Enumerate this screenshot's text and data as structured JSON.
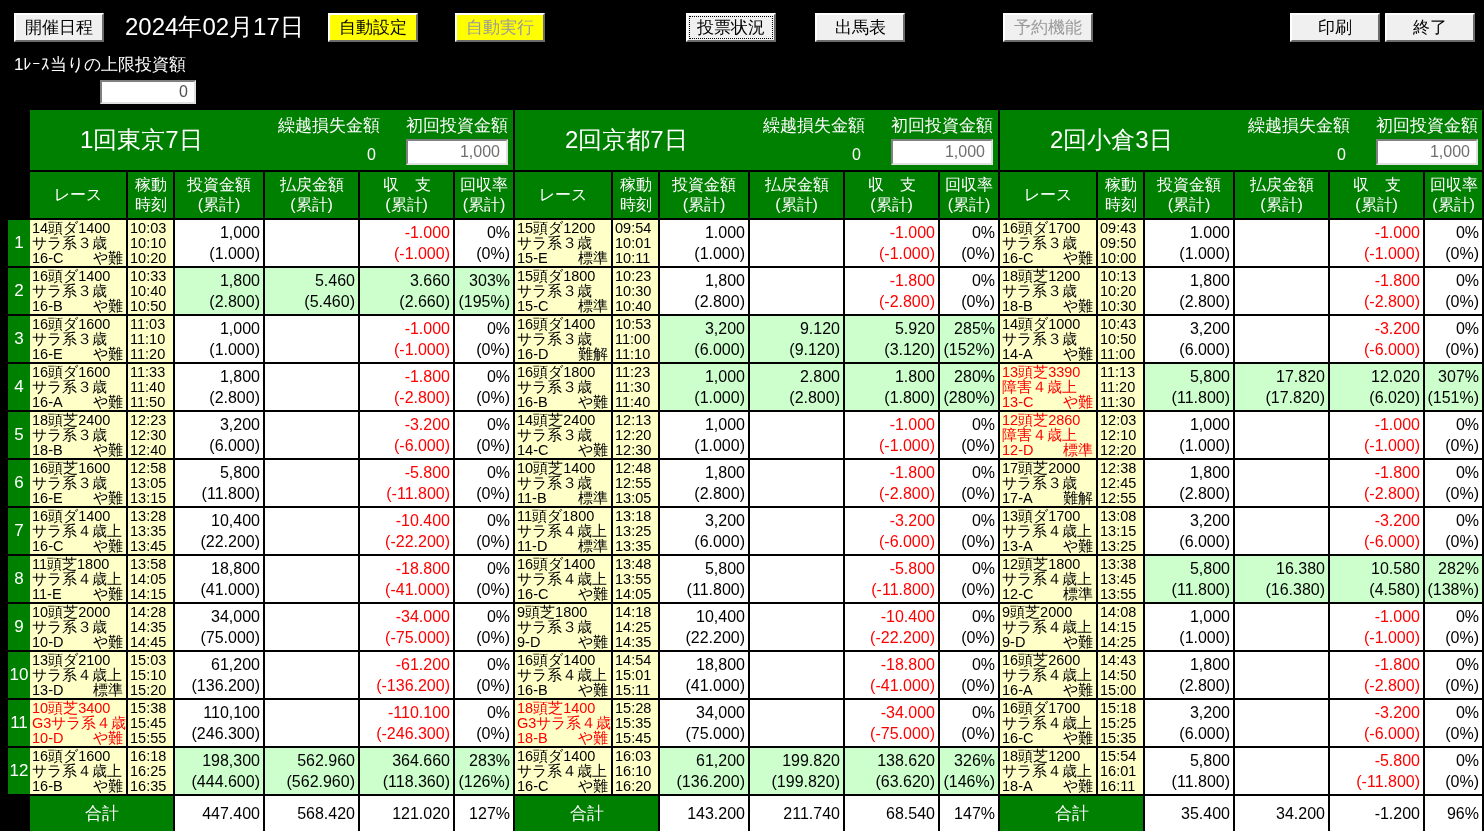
{
  "toolbar": {
    "items": [
      {
        "kind": "button",
        "label": "開催日程",
        "disabled": false,
        "focused": false
      },
      {
        "kind": "date",
        "label": "2024年02月17日"
      },
      {
        "kind": "highlighted",
        "label": "自動設定",
        "disabled": false,
        "focused": false
      },
      {
        "kind": "highlighted",
        "label": "自動実行",
        "disabled": true,
        "focused": false
      },
      {
        "kind": "button",
        "label": "投票状況",
        "disabled": false,
        "focused": true
      },
      {
        "kind": "button",
        "label": "出馬表",
        "disabled": false,
        "focused": false
      },
      {
        "kind": "button",
        "label": "予約機能",
        "disabled": true,
        "focused": false
      },
      {
        "kind": "button",
        "label": "印刷",
        "disabled": false,
        "focused": false
      },
      {
        "kind": "button",
        "label": "終了",
        "disabled": false,
        "focused": false
      }
    ]
  },
  "race_limit": {
    "label": "1ﾚｰｽ当りの上限投資額",
    "value": "0"
  },
  "row_numbers": [
    "1",
    "2",
    "3",
    "4",
    "5",
    "6",
    "7",
    "8",
    "9",
    "10",
    "11",
    "12"
  ],
  "venues": [
    {
      "name": "1回東京7日",
      "carryover_label": "繰越損失金額",
      "carryover": "0",
      "initial_label": "初回投資金額",
      "initial_amount": "1,000",
      "columns": [
        [
          "レース"
        ],
        [
          "稼動",
          "時刻"
        ],
        [
          "投資金額",
          "(累計)"
        ],
        [
          "払戻金額",
          "(累計)"
        ],
        [
          "収　支",
          "(累計)"
        ],
        [
          "回収率",
          "(累計)"
        ]
      ],
      "rows": [
        {
          "race": {
            "title": "14頭ダ1400",
            "class": "サラ系３歳",
            "code": "16-C",
            "rating": "や難",
            "marked": false
          },
          "times": [
            "10:03",
            "10:10",
            "10:20"
          ],
          "hit": false,
          "invest": [
            "1,000",
            "(1.000)"
          ],
          "balance": {
            "values": [
              "-1.000",
              "(-1.000)"
            ],
            "negative": true
          },
          "rate": [
            "0%",
            "(0%)"
          ]
        },
        {
          "race": {
            "title": "16頭ダ1400",
            "class": "サラ系３歳",
            "code": "16-B",
            "rating": "や難",
            "marked": false
          },
          "times": [
            "10:33",
            "10:40",
            "10:50"
          ],
          "hit": true,
          "invest": [
            "1,800",
            "(2.800)"
          ],
          "return": [
            "5.460",
            "(5.460)"
          ],
          "balance": {
            "values": [
              "3.660",
              "(2.660)"
            ],
            "negative": false
          },
          "rate": [
            "303%",
            "(195%)"
          ]
        },
        {
          "race": {
            "title": "16頭ダ1600",
            "class": "サラ系３歳",
            "code": "16-E",
            "rating": "や難",
            "marked": false
          },
          "times": [
            "11:03",
            "11:10",
            "11:20"
          ],
          "hit": false,
          "invest": [
            "1,000",
            "(1.000)"
          ],
          "balance": {
            "values": [
              "-1.000",
              "(-1.000)"
            ],
            "negative": true
          },
          "rate": [
            "0%",
            "(0%)"
          ]
        },
        {
          "race": {
            "title": "16頭ダ1600",
            "class": "サラ系３歳",
            "code": "16-A",
            "rating": "や難",
            "marked": false
          },
          "times": [
            "11:33",
            "11:40",
            "11:50"
          ],
          "hit": false,
          "invest": [
            "1,800",
            "(2.800)"
          ],
          "balance": {
            "values": [
              "-1.800",
              "(-2.800)"
            ],
            "negative": true
          },
          "rate": [
            "0%",
            "(0%)"
          ]
        },
        {
          "race": {
            "title": "18頭芝2400",
            "class": "サラ系３歳",
            "code": "18-B",
            "rating": "や難",
            "marked": false
          },
          "times": [
            "12:23",
            "12:30",
            "12:40"
          ],
          "hit": false,
          "invest": [
            "3,200",
            "(6.000)"
          ],
          "balance": {
            "values": [
              "-3.200",
              "(-6.000)"
            ],
            "negative": true
          },
          "rate": [
            "0%",
            "(0%)"
          ]
        },
        {
          "race": {
            "title": "16頭芝1600",
            "class": "サラ系３歳",
            "code": "16-E",
            "rating": "や難",
            "marked": false
          },
          "times": [
            "12:58",
            "13:05",
            "13:15"
          ],
          "hit": false,
          "invest": [
            "5,800",
            "(11.800)"
          ],
          "balance": {
            "values": [
              "-5.800",
              "(-11.800)"
            ],
            "negative": true
          },
          "rate": [
            "0%",
            "(0%)"
          ]
        },
        {
          "race": {
            "title": "16頭ダ1400",
            "class": "サラ系４歳上",
            "code": "16-C",
            "rating": "や難",
            "marked": false
          },
          "times": [
            "13:28",
            "13:35",
            "13:45"
          ],
          "hit": false,
          "invest": [
            "10,400",
            "(22.200)"
          ],
          "balance": {
            "values": [
              "-10.400",
              "(-22.200)"
            ],
            "negative": true
          },
          "rate": [
            "0%",
            "(0%)"
          ]
        },
        {
          "race": {
            "title": "11頭芝1800",
            "class": "サラ系４歳上",
            "code": "11-E",
            "rating": "や難",
            "marked": false
          },
          "times": [
            "13:58",
            "14:05",
            "14:15"
          ],
          "hit": false,
          "invest": [
            "18,800",
            "(41.000)"
          ],
          "balance": {
            "values": [
              "-18.800",
              "(-41.000)"
            ],
            "negative": true
          },
          "rate": [
            "0%",
            "(0%)"
          ]
        },
        {
          "race": {
            "title": "10頭芝2000",
            "class": "サラ系３歳",
            "code": "10-D",
            "rating": "や難",
            "marked": false
          },
          "times": [
            "14:28",
            "14:35",
            "14:45"
          ],
          "hit": false,
          "invest": [
            "34,000",
            "(75.000)"
          ],
          "balance": {
            "values": [
              "-34.000",
              "(-75.000)"
            ],
            "negative": true
          },
          "rate": [
            "0%",
            "(0%)"
          ]
        },
        {
          "race": {
            "title": "13頭ダ2100",
            "class": "サラ系４歳上",
            "code": "13-D",
            "rating": "標準",
            "marked": false
          },
          "times": [
            "15:03",
            "15:10",
            "15:20"
          ],
          "hit": false,
          "invest": [
            "61,200",
            "(136.200)"
          ],
          "balance": {
            "values": [
              "-61.200",
              "(-136.200)"
            ],
            "negative": true
          },
          "rate": [
            "0%",
            "(0%)"
          ]
        },
        {
          "race": {
            "title": "10頭芝3400",
            "class": "G3サラ系４歳",
            "code": "10-D",
            "rating": "や難",
            "marked": true
          },
          "times": [
            "15:38",
            "15:45",
            "15:55"
          ],
          "hit": false,
          "invest": [
            "110,100",
            "(246.300)"
          ],
          "balance": {
            "values": [
              "-110.100",
              "(-246.300)"
            ],
            "negative": true
          },
          "rate": [
            "0%",
            "(0%)"
          ]
        },
        {
          "race": {
            "title": "16頭ダ1600",
            "class": "サラ系４歳上",
            "code": "16-B",
            "rating": "や難",
            "marked": false
          },
          "times": [
            "16:18",
            "16:25",
            "16:35"
          ],
          "hit": true,
          "invest": [
            "198,300",
            "(444.600)"
          ],
          "return": [
            "562.960",
            "(562.960)"
          ],
          "balance": {
            "values": [
              "364.660",
              "(118.360)"
            ],
            "negative": false
          },
          "rate": [
            "283%",
            "(126%)"
          ]
        }
      ],
      "total": {
        "label": "合計",
        "invest": "447.400",
        "return": "568.420",
        "balance": "121.020",
        "rate": "127%"
      }
    },
    {
      "name": "2回京都7日",
      "carryover_label": "繰越損失金額",
      "carryover": "0",
      "initial_label": "初回投資金額",
      "initial_amount": "1,000",
      "columns": [
        [
          "レース"
        ],
        [
          "稼動",
          "時刻"
        ],
        [
          "投資金額",
          "(累計)"
        ],
        [
          "払戻金額",
          "(累計)"
        ],
        [
          "収　支",
          "(累計)"
        ],
        [
          "回収率",
          "(累計)"
        ]
      ],
      "rows": [
        {
          "race": {
            "title": "15頭ダ1200",
            "class": "サラ系３歳",
            "code": "15-E",
            "rating": "標準",
            "marked": false
          },
          "times": [
            "09:54",
            "10:01",
            "10:11"
          ],
          "hit": false,
          "invest": [
            "1.000",
            "(1.000)"
          ],
          "balance": {
            "values": [
              "-1.000",
              "(-1.000)"
            ],
            "negative": true
          },
          "rate": [
            "0%",
            "(0%)"
          ]
        },
        {
          "race": {
            "title": "15頭ダ1800",
            "class": "サラ系３歳",
            "code": "15-C",
            "rating": "標準",
            "marked": false
          },
          "times": [
            "10:23",
            "10:30",
            "10:40"
          ],
          "hit": false,
          "invest": [
            "1,800",
            "(2.800)"
          ],
          "balance": {
            "values": [
              "-1.800",
              "(-2.800)"
            ],
            "negative": true
          },
          "rate": [
            "0%",
            "(0%)"
          ]
        },
        {
          "race": {
            "title": "16頭ダ1400",
            "class": "サラ系３歳",
            "code": "16-D",
            "rating": "難解",
            "marked": false
          },
          "times": [
            "10:53",
            "11:00",
            "11:10"
          ],
          "hit": true,
          "invest": [
            "3,200",
            "(6.000)"
          ],
          "return": [
            "9.120",
            "(9.120)"
          ],
          "balance": {
            "values": [
              "5.920",
              "(3.120)"
            ],
            "negative": false
          },
          "rate": [
            "285%",
            "(152%)"
          ]
        },
        {
          "race": {
            "title": "16頭ダ1800",
            "class": "サラ系３歳",
            "code": "16-B",
            "rating": "や難",
            "marked": false
          },
          "times": [
            "11:23",
            "11:30",
            "11:40"
          ],
          "hit": true,
          "invest": [
            "1,000",
            "(1.000)"
          ],
          "return": [
            "2.800",
            "(2.800)"
          ],
          "balance": {
            "values": [
              "1.800",
              "(1.800)"
            ],
            "negative": false
          },
          "rate": [
            "280%",
            "(280%)"
          ]
        },
        {
          "race": {
            "title": "14頭芝2400",
            "class": "サラ系３歳",
            "code": "14-C",
            "rating": "や難",
            "marked": false
          },
          "times": [
            "12:13",
            "12:20",
            "12:30"
          ],
          "hit": false,
          "invest": [
            "1,000",
            "(1.000)"
          ],
          "balance": {
            "values": [
              "-1.000",
              "(-1.000)"
            ],
            "negative": true
          },
          "rate": [
            "0%",
            "(0%)"
          ]
        },
        {
          "race": {
            "title": "10頭芝1400",
            "class": "サラ系３歳",
            "code": "11-B",
            "rating": "標準",
            "marked": false
          },
          "times": [
            "12:48",
            "12:55",
            "13:05"
          ],
          "hit": false,
          "invest": [
            "1,800",
            "(2.800)"
          ],
          "balance": {
            "values": [
              "-1.800",
              "(-2.800)"
            ],
            "negative": true
          },
          "rate": [
            "0%",
            "(0%)"
          ]
        },
        {
          "race": {
            "title": "11頭ダ1800",
            "class": "サラ系４歳上",
            "code": "11-D",
            "rating": "標準",
            "marked": false
          },
          "times": [
            "13:18",
            "13:25",
            "13:35"
          ],
          "hit": false,
          "invest": [
            "3,200",
            "(6.000)"
          ],
          "balance": {
            "values": [
              "-3.200",
              "(-6.000)"
            ],
            "negative": true
          },
          "rate": [
            "0%",
            "(0%)"
          ]
        },
        {
          "race": {
            "title": "16頭ダ1400",
            "class": "サラ系４歳上",
            "code": "16-C",
            "rating": "や難",
            "marked": false
          },
          "times": [
            "13:48",
            "13:55",
            "14:05"
          ],
          "hit": false,
          "invest": [
            "5,800",
            "(11.800)"
          ],
          "balance": {
            "values": [
              "-5.800",
              "(-11.800)"
            ],
            "negative": true
          },
          "rate": [
            "0%",
            "(0%)"
          ]
        },
        {
          "race": {
            "title": "9頭芝1800",
            "class": "サラ系３歳",
            "code": "9-D",
            "rating": "や難",
            "marked": false
          },
          "times": [
            "14:18",
            "14:25",
            "14:35"
          ],
          "hit": false,
          "invest": [
            "10,400",
            "(22.200)"
          ],
          "balance": {
            "values": [
              "-10.400",
              "(-22.200)"
            ],
            "negative": true
          },
          "rate": [
            "0%",
            "(0%)"
          ]
        },
        {
          "race": {
            "title": "16頭ダ1400",
            "class": "サラ系４歳上",
            "code": "16-B",
            "rating": "や難",
            "marked": false
          },
          "times": [
            "14:54",
            "15:01",
            "15:11"
          ],
          "hit": false,
          "invest": [
            "18,800",
            "(41.000)"
          ],
          "balance": {
            "values": [
              "-18.800",
              "(-41.000)"
            ],
            "negative": true
          },
          "rate": [
            "0%",
            "(0%)"
          ]
        },
        {
          "race": {
            "title": "18頭芝1400",
            "class": "G3サラ系４歳",
            "code": "18-B",
            "rating": "や難",
            "marked": true
          },
          "times": [
            "15:28",
            "15:35",
            "15:45"
          ],
          "hit": false,
          "invest": [
            "34,000",
            "(75.000)"
          ],
          "balance": {
            "values": [
              "-34.000",
              "(-75.000)"
            ],
            "negative": true
          },
          "rate": [
            "0%",
            "(0%)"
          ]
        },
        {
          "race": {
            "title": "16頭ダ1400",
            "class": "サラ系４歳上",
            "code": "16-C",
            "rating": "や難",
            "marked": false
          },
          "times": [
            "16:03",
            "16:10",
            "16:20"
          ],
          "hit": true,
          "invest": [
            "61,200",
            "(136.200)"
          ],
          "return": [
            "199.820",
            "(199.820)"
          ],
          "balance": {
            "values": [
              "138.620",
              "(63.620)"
            ],
            "negative": false
          },
          "rate": [
            "326%",
            "(146%)"
          ]
        }
      ],
      "total": {
        "label": "合計",
        "invest": "143.200",
        "return": "211.740",
        "balance": "68.540",
        "rate": "147%"
      }
    },
    {
      "name": "2回小倉3日",
      "carryover_label": "繰越損失金額",
      "carryover": "0",
      "initial_label": "初回投資金額",
      "initial_amount": "1,000",
      "columns": [
        [
          "レース"
        ],
        [
          "稼動",
          "時刻"
        ],
        [
          "投資金額",
          "(累計)"
        ],
        [
          "払戻金額",
          "(累計)"
        ],
        [
          "収　支",
          "(累計)"
        ],
        [
          "回収率",
          "(累計)"
        ]
      ],
      "rows": [
        {
          "race": {
            "title": "16頭ダ1700",
            "class": "サラ系３歳",
            "code": "16-C",
            "rating": "や難",
            "marked": false
          },
          "times": [
            "09:43",
            "09:50",
            "10:00"
          ],
          "hit": false,
          "invest": [
            "1.000",
            "(1.000)"
          ],
          "balance": {
            "values": [
              "-1.000",
              "(-1.000)"
            ],
            "negative": true
          },
          "rate": [
            "0%",
            "(0%)"
          ]
        },
        {
          "race": {
            "title": "18頭芝1200",
            "class": "サラ系３歳",
            "code": "18-B",
            "rating": "や難",
            "marked": false
          },
          "times": [
            "10:13",
            "10:20",
            "10:30"
          ],
          "hit": false,
          "invest": [
            "1,800",
            "(2.800)"
          ],
          "balance": {
            "values": [
              "-1.800",
              "(-2.800)"
            ],
            "negative": true
          },
          "rate": [
            "0%",
            "(0%)"
          ]
        },
        {
          "race": {
            "title": "14頭ダ1000",
            "class": "サラ系３歳",
            "code": "14-A",
            "rating": "や難",
            "marked": false
          },
          "times": [
            "10:43",
            "10:50",
            "11:00"
          ],
          "hit": false,
          "invest": [
            "3,200",
            "(6.000)"
          ],
          "balance": {
            "values": [
              "-3.200",
              "(-6.000)"
            ],
            "negative": true
          },
          "rate": [
            "0%",
            "(0%)"
          ]
        },
        {
          "race": {
            "title": "13頭芝3390",
            "class": "障害４歳上",
            "code": "13-C",
            "rating": "や難",
            "marked": true
          },
          "times": [
            "11:13",
            "11:20",
            "11:30"
          ],
          "hit": true,
          "invest": [
            "5,800",
            "(11.800)"
          ],
          "return": [
            "17.820",
            "(17.820)"
          ],
          "balance": {
            "values": [
              "12.020",
              "(6.020)"
            ],
            "negative": false
          },
          "rate": [
            "307%",
            "(151%)"
          ]
        },
        {
          "race": {
            "title": "12頭芝2860",
            "class": "障害４歳上",
            "code": "12-D",
            "rating": "標準",
            "marked": true
          },
          "times": [
            "12:03",
            "12:10",
            "12:20"
          ],
          "hit": false,
          "invest": [
            "1,000",
            "(1.000)"
          ],
          "balance": {
            "values": [
              "-1.000",
              "(-1.000)"
            ],
            "negative": true
          },
          "rate": [
            "0%",
            "(0%)"
          ]
        },
        {
          "race": {
            "title": "17頭芝2000",
            "class": "サラ系３歳",
            "code": "17-A",
            "rating": "難解",
            "marked": false
          },
          "times": [
            "12:38",
            "12:45",
            "12:55"
          ],
          "hit": false,
          "invest": [
            "1,800",
            "(2.800)"
          ],
          "balance": {
            "values": [
              "-1.800",
              "(-2.800)"
            ],
            "negative": true
          },
          "rate": [
            "0%",
            "(0%)"
          ]
        },
        {
          "race": {
            "title": "13頭ダ1700",
            "class": "サラ系４歳上",
            "code": "13-A",
            "rating": "や難",
            "marked": false
          },
          "times": [
            "13:08",
            "13:15",
            "13:25"
          ],
          "hit": false,
          "invest": [
            "3,200",
            "(6.000)"
          ],
          "balance": {
            "values": [
              "-3.200",
              "(-6.000)"
            ],
            "negative": true
          },
          "rate": [
            "0%",
            "(0%)"
          ]
        },
        {
          "race": {
            "title": "12頭芝1800",
            "class": "サラ系４歳上",
            "code": "12-C",
            "rating": "標準",
            "marked": false
          },
          "times": [
            "13:38",
            "13:45",
            "13:55"
          ],
          "hit": true,
          "invest": [
            "5,800",
            "(11.800)"
          ],
          "return": [
            "16.380",
            "(16.380)"
          ],
          "balance": {
            "values": [
              "10.580",
              "(4.580)"
            ],
            "negative": false
          },
          "rate": [
            "282%",
            "(138%)"
          ]
        },
        {
          "race": {
            "title": "9頭芝2000",
            "class": "サラ系４歳上",
            "code": "9-D",
            "rating": "や難",
            "marked": false
          },
          "times": [
            "14:08",
            "14:15",
            "14:25"
          ],
          "hit": false,
          "invest": [
            "1,000",
            "(1.000)"
          ],
          "balance": {
            "values": [
              "-1.000",
              "(-1.000)"
            ],
            "negative": true
          },
          "rate": [
            "0%",
            "(0%)"
          ]
        },
        {
          "race": {
            "title": "16頭芝2600",
            "class": "サラ系４歳上",
            "code": "16-A",
            "rating": "や難",
            "marked": false
          },
          "times": [
            "14:43",
            "14:50",
            "15:00"
          ],
          "hit": false,
          "invest": [
            "1,800",
            "(2.800)"
          ],
          "balance": {
            "values": [
              "-1.800",
              "(-2.800)"
            ],
            "negative": true
          },
          "rate": [
            "0%",
            "(0%)"
          ]
        },
        {
          "race": {
            "title": "16頭ダ1700",
            "class": "サラ系４歳上",
            "code": "16-C",
            "rating": "や難",
            "marked": false
          },
          "times": [
            "15:18",
            "15:25",
            "15:35"
          ],
          "hit": false,
          "invest": [
            "3,200",
            "(6.000)"
          ],
          "balance": {
            "values": [
              "-3.200",
              "(-6.000)"
            ],
            "negative": true
          },
          "rate": [
            "0%",
            "(0%)"
          ]
        },
        {
          "race": {
            "title": "18頭芝1200",
            "class": "サラ系４歳上",
            "code": "18-A",
            "rating": "や難",
            "marked": false
          },
          "times": [
            "15:54",
            "16:01",
            "16:11"
          ],
          "hit": false,
          "invest": [
            "5,800",
            "(11.800)"
          ],
          "balance": {
            "values": [
              "-5.800",
              "(-11.800)"
            ],
            "negative": true
          },
          "rate": [
            "0%",
            "(0%)"
          ]
        }
      ],
      "total": {
        "label": "合計",
        "invest": "35.400",
        "return": "34.200",
        "balance": "-1.200",
        "rate": "96%"
      }
    }
  ]
}
